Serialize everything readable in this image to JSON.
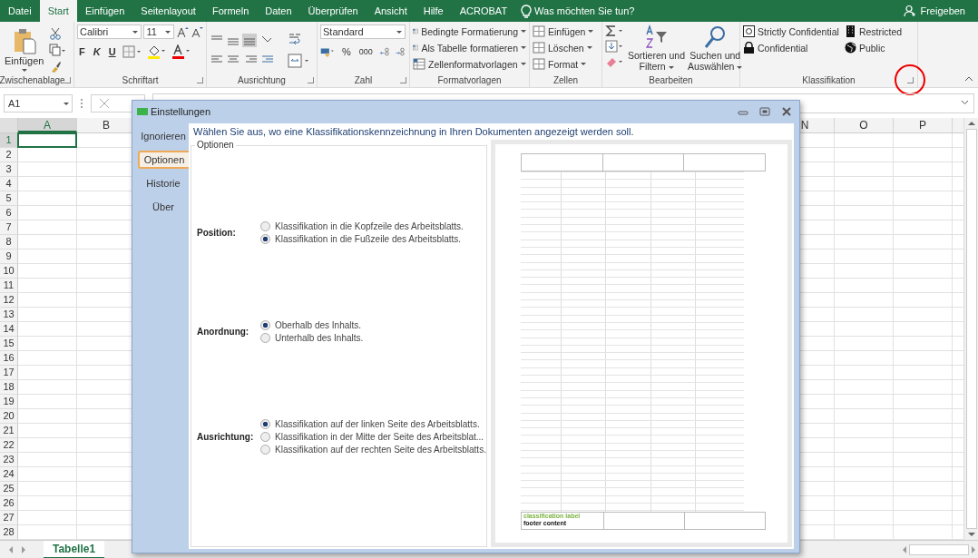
{
  "menu_tabs": [
    {
      "label": "Datei",
      "selected": false
    },
    {
      "label": "Start",
      "selected": true
    },
    {
      "label": "Einfügen",
      "selected": false
    },
    {
      "label": "Seitenlayout",
      "selected": false
    },
    {
      "label": "Formeln",
      "selected": false
    },
    {
      "label": "Daten",
      "selected": false
    },
    {
      "label": "Überprüfen",
      "selected": false
    },
    {
      "label": "Ansicht",
      "selected": false
    },
    {
      "label": "Hilfe",
      "selected": false
    },
    {
      "label": "ACROBAT",
      "selected": false
    }
  ],
  "tell_me": {
    "placeholder": "Was möchten Sie tun?"
  },
  "share_button": "Freigeben",
  "ribbon": {
    "clipboard": {
      "label": "Zwischenablage",
      "paste": "Einfügen"
    },
    "font": {
      "label": "Schriftart",
      "font_name": "Calibri",
      "font_size": "11",
      "bold": "F",
      "italic": "K",
      "underline": "U"
    },
    "alignment": {
      "label": "Ausrichtung"
    },
    "number": {
      "label": "Zahl",
      "format": "Standard",
      "percent": "%",
      "thousands": "000"
    },
    "styles": {
      "label": "Formatvorlagen",
      "items": [
        "Bedingte Formatierung",
        "Als Tabelle formatieren",
        "Zellenformatvorlagen"
      ]
    },
    "cells": {
      "label": "Zellen",
      "items": [
        "Einfügen",
        "Löschen",
        "Format"
      ]
    },
    "editing": {
      "label": "Bearbeiten",
      "sort": [
        "Sortieren und",
        "Filtern"
      ],
      "find": [
        "Suchen und",
        "Auswählen"
      ]
    },
    "classification": {
      "label": "Klassifikation",
      "items": [
        {
          "label": "Strictly Confidential",
          "kind": "safe"
        },
        {
          "label": "Restricted",
          "kind": "building"
        },
        {
          "label": "Confidential",
          "kind": "lock"
        },
        {
          "label": "Public",
          "kind": "globe"
        }
      ]
    }
  },
  "name_box": "A1",
  "columns": [
    "A",
    "B",
    "N",
    "O",
    "P"
  ],
  "rows": [
    "1",
    "2",
    "3",
    "4",
    "5",
    "6",
    "7",
    "8",
    "9",
    "10",
    "11",
    "12",
    "13",
    "14",
    "15",
    "16",
    "17",
    "18",
    "19",
    "20",
    "21",
    "22",
    "23",
    "24",
    "25",
    "26",
    "27",
    "28"
  ],
  "sheet_tabs": [
    {
      "label": "Tabelle1",
      "selected": true
    }
  ],
  "dialog": {
    "title": "Einstellungen",
    "nav": [
      {
        "label": "Ignorieren",
        "selected": false
      },
      {
        "label": "Optionen",
        "selected": true
      },
      {
        "label": "Historie",
        "selected": false
      },
      {
        "label": "Über",
        "selected": false
      }
    ],
    "instruction": "Wählen Sie aus, wo eine Klassifikationskennzeichnung in Ihren Dokumenten angezeigt werden soll.",
    "options_title": "Optionen",
    "groups": [
      {
        "label": "Position:",
        "options": [
          {
            "label": "Klassifikation in die Kopfzeile des Arbeitsblatts.",
            "selected": false
          },
          {
            "label": "Klassifikation in die Fußzeile des Arbeitsblatts.",
            "selected": true
          }
        ]
      },
      {
        "label": "Anordnung:",
        "options": [
          {
            "label": "Oberhalb des Inhalts.",
            "selected": true
          },
          {
            "label": "Unterhalb des Inhalts.",
            "selected": false
          }
        ]
      },
      {
        "label": "Ausrichtung:",
        "options": [
          {
            "label": "Klassifikation auf der linken Seite des Arbeitsblatts.",
            "selected": true
          },
          {
            "label": "Klassifikation in der Mitte der Seite des Arbeitsblat...",
            "selected": false
          },
          {
            "label": "Klassifikation auf der rechten Seite des Arbeitsblatts.",
            "selected": false
          }
        ]
      }
    ],
    "preview": {
      "classification_label": "classification label",
      "footer_content": "footer content"
    }
  }
}
